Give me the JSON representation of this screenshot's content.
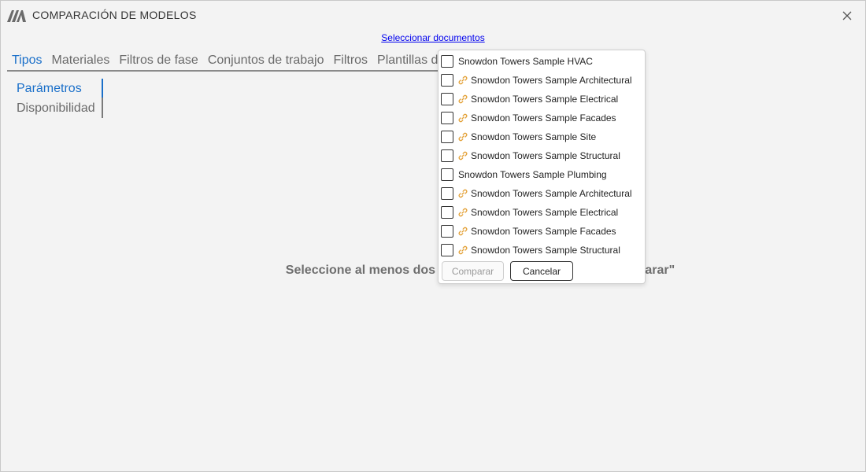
{
  "window": {
    "title": "COMPARACIÓN DE MODELOS",
    "logo_icon": "logo-icon",
    "close_icon": "close-icon"
  },
  "select_documents_link": "Seleccionar documentos",
  "tabs": [
    {
      "label": "Tipos",
      "active": true
    },
    {
      "label": "Materiales",
      "active": false
    },
    {
      "label": "Filtros de fase",
      "active": false
    },
    {
      "label": "Conjuntos de trabajo",
      "active": false
    },
    {
      "label": "Filtros",
      "active": false
    },
    {
      "label": "Plantillas de",
      "active": false
    }
  ],
  "subtabs": [
    {
      "label": "Parámetros",
      "active": true
    },
    {
      "label": "Disponibilidad",
      "active": false
    }
  ],
  "empty_message": "Seleccione al menos dos documentos y haga clic en \"Comparar\"",
  "document_picker": {
    "items": [
      {
        "label": "Snowdon Towers Sample HVAC",
        "linked": false,
        "checked": false
      },
      {
        "label": "Snowdon Towers Sample Architectural",
        "linked": true,
        "checked": false
      },
      {
        "label": "Snowdon Towers Sample Electrical",
        "linked": true,
        "checked": false
      },
      {
        "label": "Snowdon Towers Sample Facades",
        "linked": true,
        "checked": false
      },
      {
        "label": "Snowdon Towers Sample Site",
        "linked": true,
        "checked": false
      },
      {
        "label": "Snowdon Towers Sample Structural",
        "linked": true,
        "checked": false
      },
      {
        "label": "Snowdon Towers Sample Plumbing",
        "linked": false,
        "checked": false
      },
      {
        "label": "Snowdon Towers Sample Architectural",
        "linked": true,
        "checked": false
      },
      {
        "label": "Snowdon Towers Sample Electrical",
        "linked": true,
        "checked": false
      },
      {
        "label": "Snowdon Towers Sample Facades",
        "linked": true,
        "checked": false
      },
      {
        "label": "Snowdon Towers Sample Structural",
        "linked": true,
        "checked": false
      }
    ],
    "compare_label": "Comparar",
    "cancel_label": "Cancelar",
    "link_icon": "link-icon"
  },
  "colors": {
    "accent": "#1a6fc9",
    "link_icon": "#e3a035",
    "hyperlink": "#0000ee"
  }
}
